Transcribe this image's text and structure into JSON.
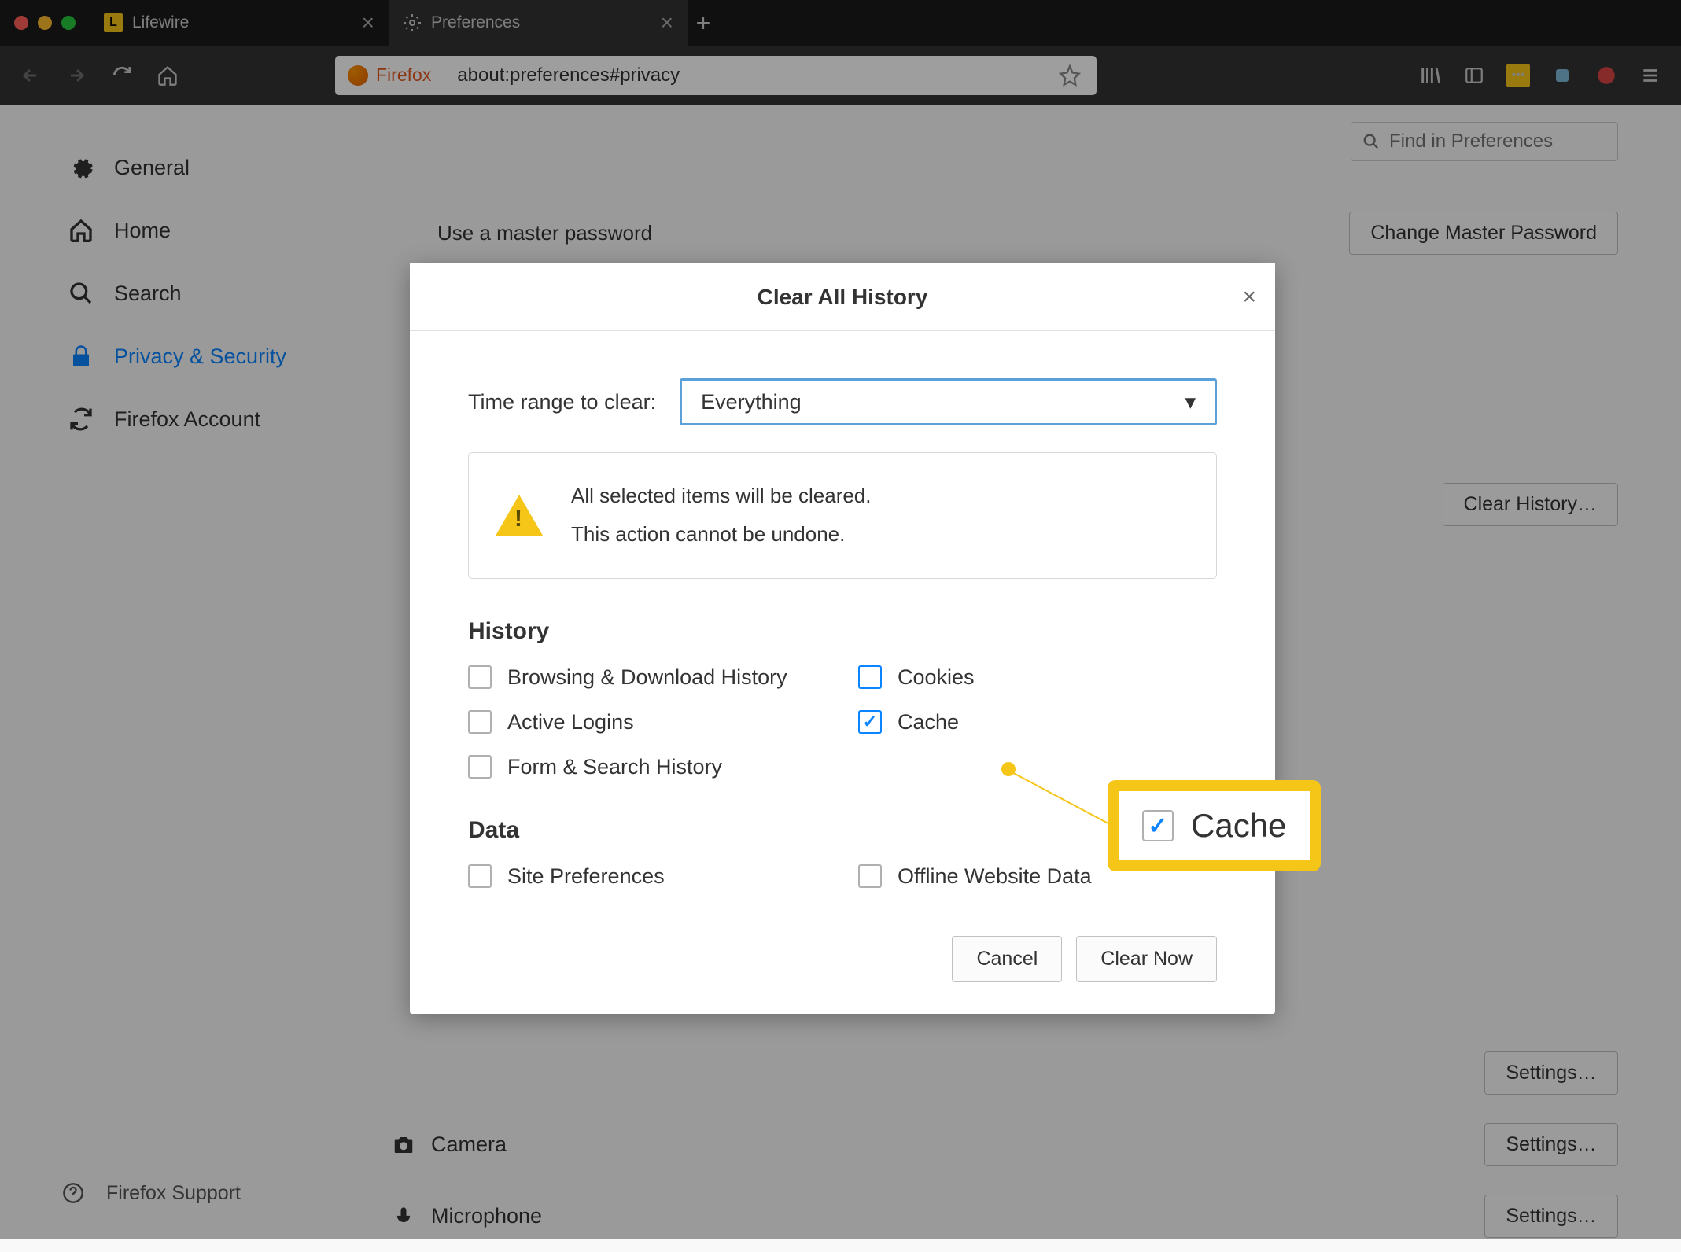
{
  "window": {
    "tabs": [
      {
        "title": "Lifewire",
        "favicon": "L"
      },
      {
        "title": "Preferences"
      }
    ]
  },
  "urlbar": {
    "identity": "Firefox",
    "address": "about:preferences#privacy"
  },
  "sidebar": {
    "items": [
      {
        "label": "General"
      },
      {
        "label": "Home"
      },
      {
        "label": "Search"
      },
      {
        "label": "Privacy & Security"
      },
      {
        "label": "Firefox Account"
      }
    ],
    "support": "Firefox Support"
  },
  "search": {
    "placeholder": "Find in Preferences"
  },
  "content": {
    "master_pw_label": "Use a master password",
    "change_master_pw": "Change Master Password",
    "clear_history_btn": "Clear History…",
    "permissions": {
      "camera": {
        "label": "Camera",
        "btn": "Settings…"
      },
      "microphone": {
        "label": "Microphone",
        "btn": "Settings…"
      },
      "extra_btn": "Settings…"
    }
  },
  "dialog": {
    "title": "Clear All History",
    "range_label": "Time range to clear:",
    "range_value": "Everything",
    "warning_line1": "All selected items will be cleared.",
    "warning_line2": "This action cannot be undone.",
    "history_heading": "History",
    "data_heading": "Data",
    "checks": {
      "browsing": "Browsing & Download History",
      "cookies": "Cookies",
      "active_logins": "Active Logins",
      "cache": "Cache",
      "form_search": "Form & Search History",
      "site_prefs": "Site Preferences",
      "offline": "Offline Website Data"
    },
    "cancel": "Cancel",
    "clear_now": "Clear Now"
  },
  "callout": {
    "label": "Cache"
  }
}
